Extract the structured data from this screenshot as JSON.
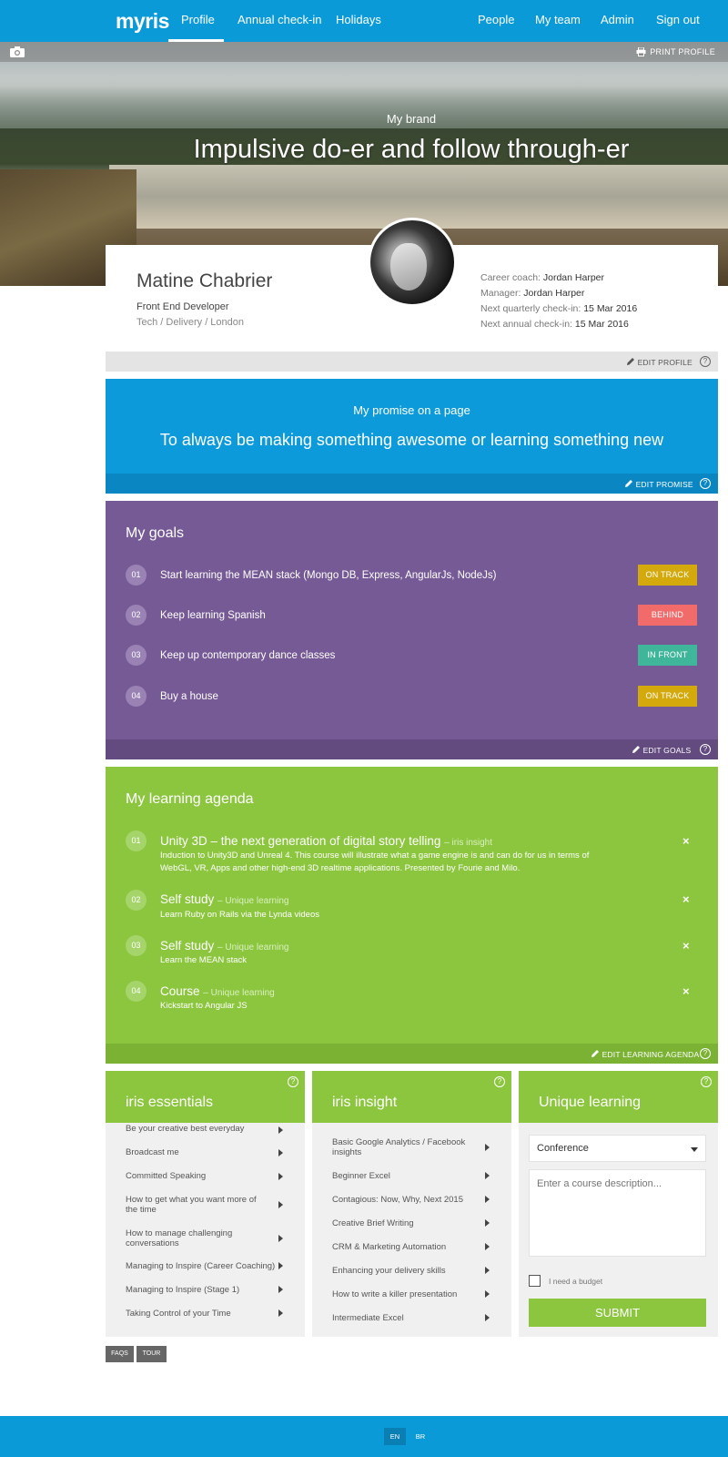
{
  "nav": {
    "logo": "myris",
    "left_items": [
      "Profile",
      "Annual check-in",
      "Holidays"
    ],
    "right_items": [
      "People",
      "My team",
      "Admin",
      "Sign out"
    ],
    "active": "Profile"
  },
  "hero": {
    "print_label": "PRINT PROFILE",
    "brand_label": "My brand",
    "brand_title": "Impulsive do-er and follow through-er"
  },
  "profile": {
    "name": "Matine Chabrier",
    "role": "Front End Developer",
    "location": "Tech / Delivery / London",
    "coach_label": "Career coach:",
    "coach": "Jordan Harper",
    "manager_label": "Manager:",
    "manager": "Jordan Harper",
    "quarterly_label": "Next quarterly check-in:",
    "quarterly": "15 Mar 2016",
    "annual_label": "Next annual check-in:",
    "annual": "15 Mar 2016",
    "edit_label": "EDIT PROFILE"
  },
  "promise": {
    "label": "My promise on a page",
    "text": "To always be making something awesome or learning something new",
    "edit_label": "EDIT PROMISE"
  },
  "goals": {
    "title": "My goals",
    "edit_label": "EDIT GOALS",
    "items": [
      {
        "num": "01",
        "text": "Start learning the MEAN stack (Mongo DB, Express, AngularJs, NodeJs)",
        "status": "ON TRACK",
        "color": "#d4a90c"
      },
      {
        "num": "02",
        "text": "Keep learning Spanish",
        "status": "BEHIND",
        "color": "#f26b6b"
      },
      {
        "num": "03",
        "text": "Keep up contemporary dance classes",
        "status": "IN FRONT",
        "color": "#3fb59a"
      },
      {
        "num": "04",
        "text": "Buy a house",
        "status": "ON TRACK",
        "color": "#d4a90c"
      }
    ]
  },
  "learning": {
    "title": "My learning agenda",
    "edit_label": "EDIT LEARNING AGENDA",
    "items": [
      {
        "num": "01",
        "title": "Unity 3D – the next generation of digital story telling",
        "source": "– iris insight",
        "desc": "Induction to Unity3D and Unreal 4. This course will illustrate what a game engine is and can do for us in terms of WebGL, VR, Apps and other high-end 3D realtime applications. Presented by Fourie and Milo."
      },
      {
        "num": "02",
        "title": "Self study",
        "source": "– Unique learning",
        "desc": "Learn Ruby on Rails via the Lynda videos"
      },
      {
        "num": "03",
        "title": "Self study",
        "source": "– Unique learning",
        "desc": "Learn the MEAN stack"
      },
      {
        "num": "04",
        "title": "Course",
        "source": "– Unique learning",
        "desc": "Kickstart to Angular JS"
      }
    ]
  },
  "essentials": {
    "title": "iris essentials",
    "items": [
      "Be your creative best everyday",
      "Broadcast me",
      "Committed Speaking",
      "How to get what you want more of the time",
      "How to manage challenging conversations",
      "Managing to Inspire (Career Coaching)",
      "Managing to Inspire (Stage 1)",
      "Taking Control of your Time"
    ]
  },
  "insight": {
    "title": "iris insight",
    "items": [
      "Basic Google Analytics / Facebook insights",
      "Beginner Excel",
      "Contagious: Now, Why, Next 2015",
      "Creative Brief Writing",
      "CRM & Marketing Automation",
      "Enhancing your delivery skills",
      "How to write a killer presentation",
      "Intermediate Excel"
    ]
  },
  "unique": {
    "title": "Unique learning",
    "select_value": "Conference",
    "placeholder": "Enter a course description...",
    "budget_label": "I need a budget",
    "submit_label": "SUBMIT"
  },
  "bottom_buttons": [
    "FAQS",
    "TOUR"
  ],
  "footer": {
    "languages": [
      "EN",
      "BR"
    ],
    "active": "EN"
  }
}
